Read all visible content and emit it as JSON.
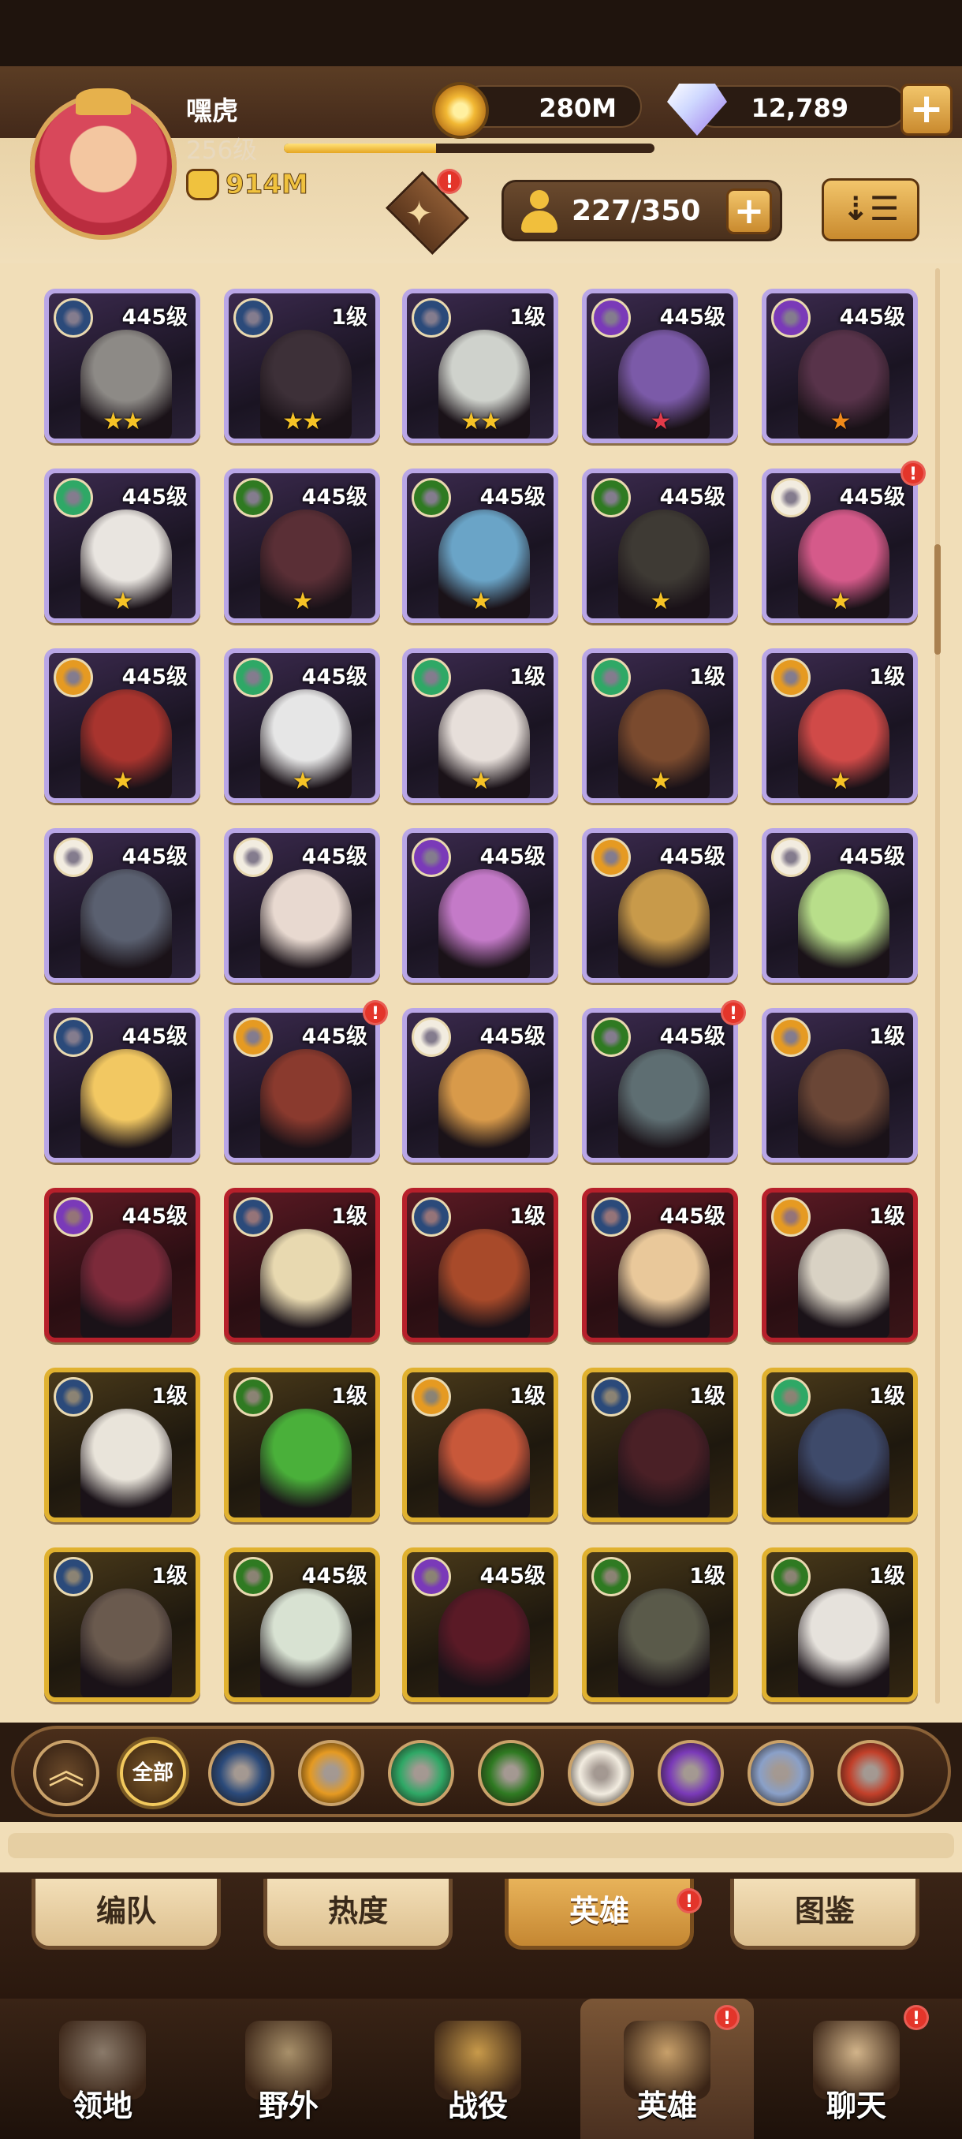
{
  "player": {
    "name": "嘿虎",
    "level": "256级",
    "power": "914M",
    "xp_fraction": 0.41
  },
  "currency": {
    "gold": "280M",
    "diamonds": "12,789",
    "plus": "+"
  },
  "hero_count": "227/350",
  "sort_icon": "sort-descending-icon",
  "heroes": [
    {
      "level": "445级",
      "faction": "lightbearer",
      "stars": "★★",
      "star_color": "gold",
      "rarity": "legend",
      "alert": false,
      "palette": "#8d8a86"
    },
    {
      "level": "1级",
      "faction": "lightbearer",
      "stars": "★★",
      "star_color": "gold",
      "rarity": "legend",
      "alert": false,
      "palette": "#3d3038"
    },
    {
      "level": "1级",
      "faction": "lightbearer",
      "stars": "★★",
      "star_color": "gold",
      "rarity": "legend",
      "alert": false,
      "palette": "#cfd2cc"
    },
    {
      "level": "445级",
      "faction": "hypogean",
      "stars": "★",
      "star_color": "red",
      "rarity": "legend",
      "alert": false,
      "palette": "#7b5aa8"
    },
    {
      "level": "445级",
      "faction": "hypogean",
      "stars": "★",
      "star_color": "orange",
      "rarity": "legend",
      "alert": false,
      "palette": "#58334a"
    },
    {
      "level": "445级",
      "faction": "wilder",
      "stars": "★",
      "star_color": "gold",
      "rarity": "legend",
      "alert": false,
      "palette": "#e9e5e0"
    },
    {
      "level": "445级",
      "faction": "graveborn",
      "stars": "★",
      "star_color": "gold",
      "rarity": "legend",
      "alert": false,
      "palette": "#5a2f36"
    },
    {
      "level": "445级",
      "faction": "graveborn",
      "stars": "★",
      "star_color": "gold",
      "rarity": "legend",
      "alert": false,
      "palette": "#6aa4c7"
    },
    {
      "level": "445级",
      "faction": "graveborn",
      "stars": "★",
      "star_color": "gold",
      "rarity": "legend",
      "alert": false,
      "palette": "#3e3a34"
    },
    {
      "level": "445级",
      "faction": "celestial",
      "stars": "★",
      "star_color": "gold",
      "rarity": "legend",
      "alert": true,
      "palette": "#d55a8a"
    },
    {
      "level": "445级",
      "faction": "mauler",
      "stars": "★",
      "star_color": "gold",
      "rarity": "legend",
      "alert": false,
      "palette": "#a8342e"
    },
    {
      "level": "445级",
      "faction": "wilder",
      "stars": "★",
      "star_color": "gold",
      "rarity": "legend",
      "alert": false,
      "palette": "#e6e6e6"
    },
    {
      "level": "1级",
      "faction": "wilder",
      "stars": "★",
      "star_color": "gold",
      "rarity": "legend",
      "alert": false,
      "palette": "#e7dfda"
    },
    {
      "level": "1级",
      "faction": "wilder",
      "stars": "★",
      "star_color": "gold",
      "rarity": "legend",
      "alert": false,
      "palette": "#7a4a2e"
    },
    {
      "level": "1级",
      "faction": "mauler",
      "stars": "★",
      "star_color": "gold",
      "rarity": "legend",
      "alert": false,
      "palette": "#d04a48"
    },
    {
      "level": "445级",
      "faction": "celestial",
      "stars": "",
      "star_color": "gold",
      "rarity": "legend",
      "alert": false,
      "palette": "#5a6070"
    },
    {
      "level": "445级",
      "faction": "celestial",
      "stars": "",
      "star_color": "gold",
      "rarity": "legend",
      "alert": false,
      "palette": "#e8d9d0"
    },
    {
      "level": "445级",
      "faction": "hypogean",
      "stars": "",
      "star_color": "gold",
      "rarity": "legend",
      "alert": false,
      "palette": "#c47ac8"
    },
    {
      "level": "445级",
      "faction": "mauler",
      "stars": "",
      "star_color": "gold",
      "rarity": "legend",
      "alert": false,
      "palette": "#c89a4a"
    },
    {
      "level": "445级",
      "faction": "celestial",
      "stars": "",
      "star_color": "gold",
      "rarity": "legend",
      "alert": false,
      "palette": "#b8de8a"
    },
    {
      "level": "445级",
      "faction": "lightbearer",
      "stars": "",
      "star_color": "gold",
      "rarity": "legend",
      "alert": false,
      "palette": "#f2c862"
    },
    {
      "level": "445级",
      "faction": "mauler",
      "stars": "",
      "star_color": "gold",
      "rarity": "legend",
      "alert": true,
      "palette": "#8a3a2e"
    },
    {
      "level": "445级",
      "faction": "celestial",
      "stars": "",
      "star_color": "gold",
      "rarity": "legend",
      "alert": false,
      "palette": "#d89a4a"
    },
    {
      "level": "445级",
      "faction": "graveborn",
      "stars": "",
      "star_color": "gold",
      "rarity": "legend",
      "alert": true,
      "palette": "#5e6e72"
    },
    {
      "level": "1级",
      "faction": "mauler",
      "stars": "",
      "star_color": "gold",
      "rarity": "legend",
      "alert": false,
      "palette": "#6a4636"
    },
    {
      "level": "445级",
      "faction": "hypogean",
      "stars": "",
      "star_color": "gold",
      "rarity": "mythic",
      "alert": false,
      "palette": "#7c2a3a"
    },
    {
      "level": "1级",
      "faction": "lightbearer",
      "stars": "",
      "star_color": "gold",
      "rarity": "mythic",
      "alert": false,
      "palette": "#e8d9b0"
    },
    {
      "level": "1级",
      "faction": "lightbearer",
      "stars": "",
      "star_color": "gold",
      "rarity": "mythic",
      "alert": false,
      "palette": "#a84a2a"
    },
    {
      "level": "445级",
      "faction": "lightbearer",
      "stars": "",
      "star_color": "gold",
      "rarity": "mythic",
      "alert": false,
      "palette": "#e9c89a"
    },
    {
      "level": "1级",
      "faction": "mauler",
      "stars": "",
      "star_color": "gold",
      "rarity": "mythic",
      "alert": false,
      "palette": "#d9d2c4"
    },
    {
      "level": "1级",
      "faction": "lightbearer",
      "stars": "",
      "star_color": "gold",
      "rarity": "ascended",
      "alert": false,
      "palette": "#e9e4da"
    },
    {
      "level": "1级",
      "faction": "graveborn",
      "stars": "",
      "star_color": "gold",
      "rarity": "ascended",
      "alert": false,
      "palette": "#4ab03a"
    },
    {
      "level": "1级",
      "faction": "mauler",
      "stars": "",
      "star_color": "gold",
      "rarity": "ascended",
      "alert": false,
      "palette": "#c8583a"
    },
    {
      "level": "1级",
      "faction": "lightbearer",
      "stars": "",
      "star_color": "gold",
      "rarity": "ascended",
      "alert": false,
      "palette": "#4a2026"
    },
    {
      "level": "1级",
      "faction": "wilder",
      "stars": "",
      "star_color": "gold",
      "rarity": "ascended",
      "alert": false,
      "palette": "#3e4a6a"
    },
    {
      "level": "1级",
      "faction": "lightbearer",
      "stars": "",
      "star_color": "gold",
      "rarity": "ascended",
      "alert": false,
      "palette": "#6a5a4e"
    },
    {
      "level": "445级",
      "faction": "graveborn",
      "stars": "",
      "star_color": "gold",
      "rarity": "ascended",
      "alert": false,
      "palette": "#d8e2d2"
    },
    {
      "level": "445级",
      "faction": "hypogean",
      "stars": "",
      "star_color": "gold",
      "rarity": "ascended",
      "alert": false,
      "palette": "#5a1a26"
    },
    {
      "level": "1级",
      "faction": "graveborn",
      "stars": "",
      "star_color": "gold",
      "rarity": "ascended",
      "alert": false,
      "palette": "#5a5a4a"
    },
    {
      "level": "1级",
      "faction": "graveborn",
      "stars": "",
      "star_color": "gold",
      "rarity": "ascended",
      "alert": false,
      "palette": "#e6e2dc"
    }
  ],
  "faction_colors": {
    "lightbearer": "#2b4a7a",
    "mauler": "#e59a22",
    "wilder": "#2fa866",
    "graveborn": "#2f7a22",
    "celestial": "#f2ece0",
    "hypogean": "#7a3ab8",
    "dimensional": "#8aa0c8",
    "draconis": "#c2402a"
  },
  "filters": {
    "collapse_icon": "double-chevron-up-icon",
    "all_label": "全部",
    "factions": [
      "lightbearer",
      "mauler",
      "wilder",
      "graveborn",
      "celestial",
      "hypogean",
      "dimensional",
      "draconis"
    ]
  },
  "subtabs": [
    {
      "label": "编队",
      "active": false,
      "alert": false
    },
    {
      "label": "热度",
      "active": false,
      "alert": false
    },
    {
      "label": "英雄",
      "active": true,
      "alert": true
    },
    {
      "label": "图鉴",
      "active": false,
      "alert": false
    }
  ],
  "nav": [
    {
      "label": "领地",
      "icon": "castle-icon",
      "active": false,
      "alert": false
    },
    {
      "label": "野外",
      "icon": "scroll-map-icon",
      "active": false,
      "alert": false
    },
    {
      "label": "战役",
      "icon": "sword-wings-icon",
      "active": false,
      "alert": false
    },
    {
      "label": "英雄",
      "icon": "helmet-icon",
      "active": true,
      "alert": true
    },
    {
      "label": "聊天",
      "icon": "chat-bubble-icon",
      "active": false,
      "alert": true
    }
  ],
  "alert_mark": "!"
}
